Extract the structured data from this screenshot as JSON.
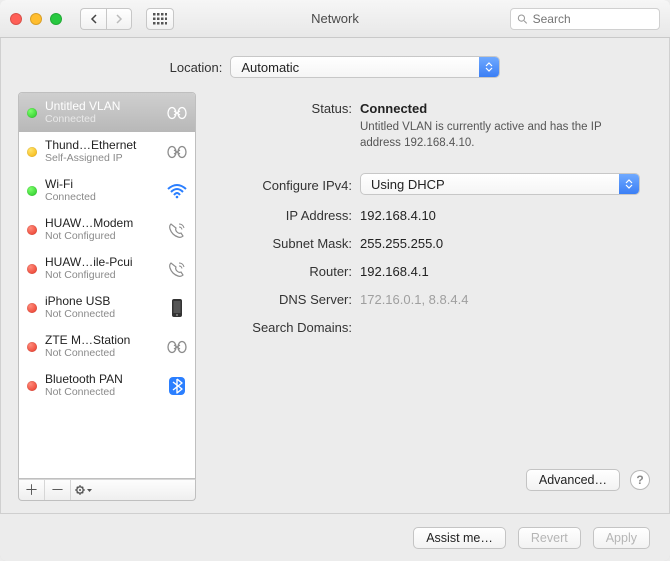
{
  "window": {
    "title": "Network"
  },
  "toolbar": {
    "search_placeholder": "Search"
  },
  "location": {
    "label": "Location:",
    "value": "Automatic"
  },
  "sidebar": {
    "items": [
      {
        "name": "Untitled VLAN",
        "sub": "Connected",
        "status": "green",
        "icon": "vlan",
        "selected": true
      },
      {
        "name": "Thund…Ethernet",
        "sub": "Self-Assigned IP",
        "status": "yellow",
        "icon": "vlan"
      },
      {
        "name": "Wi-Fi",
        "sub": "Connected",
        "status": "green",
        "icon": "wifi"
      },
      {
        "name": "HUAW…Modem",
        "sub": "Not Configured",
        "status": "red",
        "icon": "phone"
      },
      {
        "name": "HUAW…ile-Pcui",
        "sub": "Not Configured",
        "status": "red",
        "icon": "phone"
      },
      {
        "name": "iPhone USB",
        "sub": "Not Connected",
        "status": "red",
        "icon": "iphone"
      },
      {
        "name": "ZTE M…Station",
        "sub": "Not Connected",
        "status": "red",
        "icon": "vlan"
      },
      {
        "name": "Bluetooth PAN",
        "sub": "Not Connected",
        "status": "red",
        "icon": "bluetooth"
      }
    ]
  },
  "detail": {
    "status_label": "Status:",
    "status_value": "Connected",
    "status_desc": "Untitled VLAN is currently active and has the IP address 192.168.4.10.",
    "configure_label": "Configure IPv4:",
    "configure_value": "Using DHCP",
    "ip_label": "IP Address:",
    "ip_value": "192.168.4.10",
    "mask_label": "Subnet Mask:",
    "mask_value": "255.255.255.0",
    "router_label": "Router:",
    "router_value": "192.168.4.1",
    "dns_label": "DNS Server:",
    "dns_value": "172.16.0.1, 8.8.4.4",
    "search_label": "Search Domains:",
    "search_value": ""
  },
  "buttons": {
    "advanced": "Advanced…",
    "assist": "Assist me…",
    "revert": "Revert",
    "apply": "Apply"
  }
}
